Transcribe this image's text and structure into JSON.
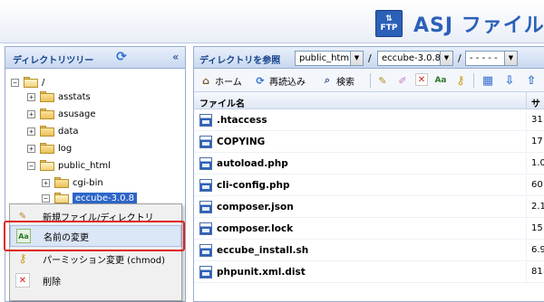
{
  "header": {
    "logo_badge": "FTP",
    "logo_arrows": "⇅",
    "title": "ASJ ファイル"
  },
  "left_panel": {
    "title": "ディレクトリツリー",
    "collapse_glyph": "«",
    "tree": [
      {
        "label": "/",
        "level": 0,
        "expander": "−",
        "open": true
      },
      {
        "label": "asstats",
        "level": 1,
        "expander": "+",
        "open": false
      },
      {
        "label": "asusage",
        "level": 1,
        "expander": "+",
        "open": false
      },
      {
        "label": "data",
        "level": 1,
        "expander": "+",
        "open": false
      },
      {
        "label": "log",
        "level": 1,
        "expander": "+",
        "open": false
      },
      {
        "label": "public_html",
        "level": 1,
        "expander": "−",
        "open": true
      },
      {
        "label": "cgi-bin",
        "level": 2,
        "expander": "+",
        "open": false
      },
      {
        "label": "eccube-3.0.8",
        "level": 2,
        "expander": "−",
        "open": true,
        "selected": true
      }
    ]
  },
  "context_menu": {
    "items": [
      {
        "label": "新規ファイル/ディレクトリ",
        "icon": "new-file-icon",
        "glyph": "✎"
      },
      {
        "label": "名前の変更",
        "icon": "rename-icon",
        "glyph": "Aa",
        "hover": true
      },
      {
        "label": "パーミッション変更 (chmod)",
        "icon": "key-icon",
        "glyph": "⚷"
      },
      {
        "label": "削除",
        "icon": "delete-icon",
        "glyph": "✕"
      }
    ]
  },
  "right_panel": {
    "path_title": "ディレクトリを参照",
    "path_selects": [
      "public_html",
      "eccube-3.0.8",
      "- - - - -"
    ],
    "toolbar": {
      "home": "ホーム",
      "reload": "再読込み",
      "search": "検索"
    },
    "columns": {
      "name": "ファイル名",
      "size": "サ"
    },
    "files": [
      {
        "name": ".htaccess",
        "size": "31"
      },
      {
        "name": "COPYING",
        "size": "17"
      },
      {
        "name": "autoload.php",
        "size": "1.0"
      },
      {
        "name": "cli-config.php",
        "size": "60"
      },
      {
        "name": "composer.json",
        "size": "2.1"
      },
      {
        "name": "composer.lock",
        "size": "15"
      },
      {
        "name": "eccube_install.sh",
        "size": "6.9"
      },
      {
        "name": "phpunit.xml.dist",
        "size": "81"
      }
    ]
  },
  "colors": {
    "accent": "#2b60b8",
    "panel_title": "#15428b",
    "selection": "#2d66c8",
    "highlight_box": "#e02020"
  }
}
